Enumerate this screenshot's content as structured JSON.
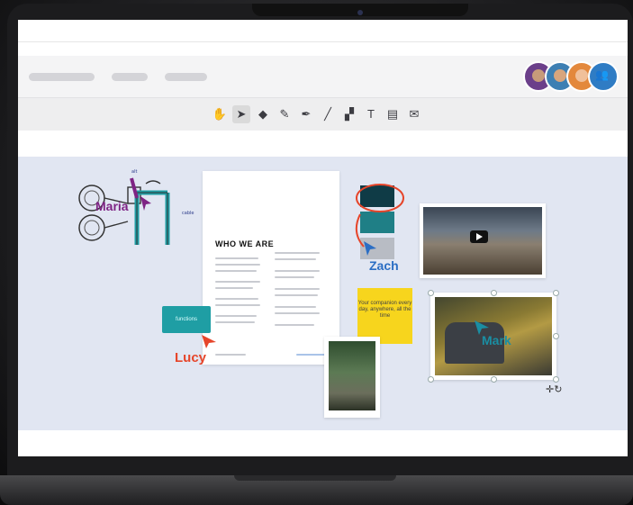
{
  "avatars": [
    {
      "name": "avatar-1",
      "bg": "#6b3f8a",
      "face": "#c79b7a"
    },
    {
      "name": "avatar-2",
      "bg": "#3d7fb3",
      "face": "#d8a57d"
    },
    {
      "name": "avatar-3",
      "bg": "#e3883c",
      "face": "#f0c09a"
    },
    {
      "name": "avatar-4",
      "bg": "#2f7cc4",
      "icon": "people-icon"
    }
  ],
  "toolbar": {
    "tools": [
      "hand-icon",
      "pointer-icon",
      "eraser-icon",
      "pen-icon",
      "highlighter-icon",
      "line-icon",
      "shapes-icon",
      "text-icon",
      "sticky-note-icon",
      "comment-icon"
    ],
    "glyphs": [
      "✋",
      "➤",
      "◆",
      "✎",
      "✒",
      "╱",
      "▞",
      "T",
      "▤",
      "✉"
    ],
    "active": "pointer-icon"
  },
  "document": {
    "title": "WHO WE ARE"
  },
  "cursors": {
    "maria": "Maria",
    "zach": "Zach",
    "lucy": "Lucy",
    "mark": "Mark"
  },
  "sticky": {
    "text": "Your companion every day, anywhere, all the time"
  },
  "teal_note": {
    "text": "functions"
  },
  "swatches": [
    "#0f3b46",
    "#1f7f86",
    "#b8bcc4"
  ],
  "colors": {
    "canvas": "#e1e6f2",
    "maria": "#7e2384",
    "zach": "#2b6ec4",
    "lucy": "#e6452a",
    "mark": "#1a8ea3",
    "sticky": "#f7d51d",
    "teal": "#1f9ea4"
  }
}
